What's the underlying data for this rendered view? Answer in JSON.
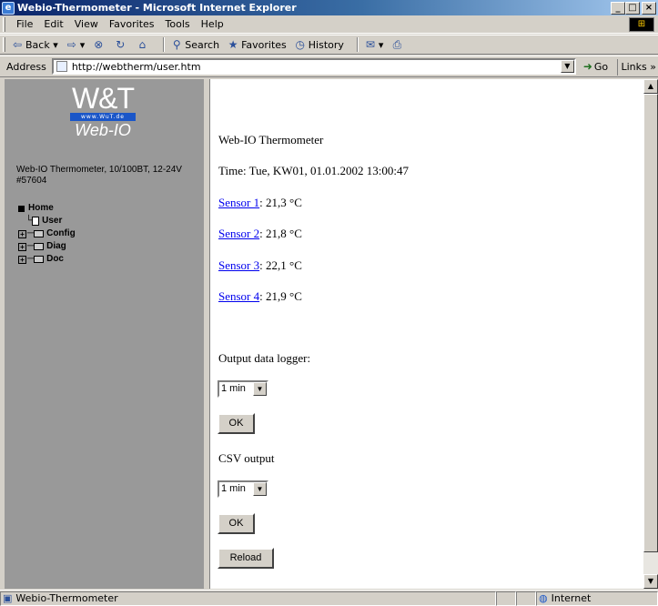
{
  "window": {
    "title": "Webio-Thermometer - Microsoft Internet Explorer"
  },
  "menu": [
    "File",
    "Edit",
    "View",
    "Favorites",
    "Tools",
    "Help"
  ],
  "toolbar": {
    "back": "Back",
    "search": "Search",
    "favorites": "Favorites",
    "history": "History"
  },
  "address": {
    "label": "Address",
    "url": "http://webtherm/user.htm",
    "go": "Go",
    "links": "Links"
  },
  "sidebar": {
    "logo": {
      "brand": "W&T",
      "url": "www.WuT.de",
      "product": "Web-IO"
    },
    "device_line1": "Web-IO Thermometer, 10/100BT, 12-24V",
    "device_line2": "#57604",
    "tree": {
      "home": "Home",
      "user": "User",
      "config": "Config",
      "diag": "Diag",
      "doc": "Doc"
    }
  },
  "main": {
    "heading": "Web-IO Thermometer",
    "time": "Time: Tue, KW01, 01.01.2002 13:00:47",
    "sensors": [
      {
        "name": "Sensor 1",
        "value": ": 21,3 °C"
      },
      {
        "name": "Sensor 2",
        "value": ": 21,8 °C"
      },
      {
        "name": "Sensor 3",
        "value": ": 22,1 °C"
      },
      {
        "name": "Sensor 4",
        "value": ": 21,9 °C"
      }
    ],
    "logger_label": "Output data logger:",
    "logger_select": "1 min",
    "ok": "OK",
    "csv_label": "CSV output",
    "csv_select": "1 min",
    "reload": "Reload"
  },
  "status": {
    "text": "Webio-Thermometer",
    "zone": "Internet"
  }
}
